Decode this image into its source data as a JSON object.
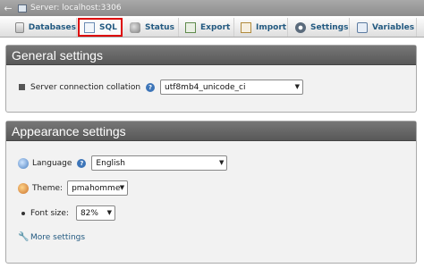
{
  "titlebar": {
    "back_icon": "back-arrow-icon",
    "server_icon": "server-icon",
    "title": "Server: localhost:3306"
  },
  "tabs": [
    {
      "label": "Databases",
      "icon": "database-icon"
    },
    {
      "label": "SQL",
      "icon": "sql-icon",
      "active": true
    },
    {
      "label": "Status",
      "icon": "status-icon"
    },
    {
      "label": "Export",
      "icon": "export-icon"
    },
    {
      "label": "Import",
      "icon": "import-icon"
    },
    {
      "label": "Settings",
      "icon": "settings-icon"
    },
    {
      "label": "Variables",
      "icon": "variables-icon"
    }
  ],
  "general": {
    "heading": "General settings",
    "collation_label": "Server connection collation",
    "collation_value": "utf8mb4_unicode_ci"
  },
  "appearance": {
    "heading": "Appearance settings",
    "language_label": "Language",
    "language_value": "English",
    "theme_label": "Theme:",
    "theme_value": "pmahomme",
    "fontsize_label": "Font size:",
    "fontsize_value": "82%",
    "more_settings": "More settings"
  },
  "colors": {
    "accent_link": "#235a81",
    "panel_header": "#666666",
    "active_tab_border": "#dd0000"
  }
}
